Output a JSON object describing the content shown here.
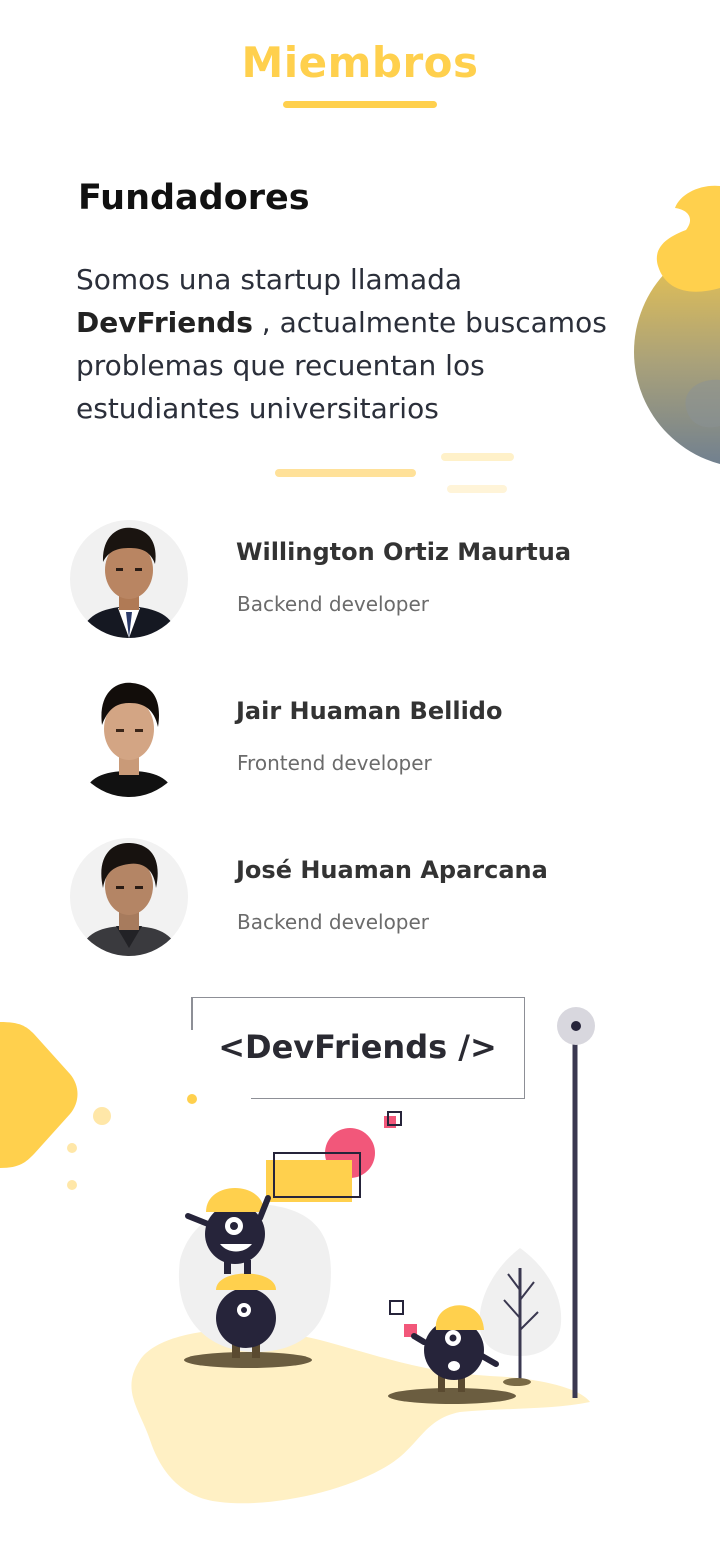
{
  "header": {
    "title": "Miembros"
  },
  "founders": {
    "title": "Fundadores",
    "intro_before": "Somos una startup llamada",
    "intro_brand": "DevFriends",
    "intro_after": ", actualmente buscamos problemas que recuentan los estudiantes universitarios"
  },
  "members": [
    {
      "name": "Willington Ortiz Maurtua",
      "role": "Backend developer"
    },
    {
      "name": "Jair Huaman Bellido",
      "role": "Frontend developer"
    },
    {
      "name": "José Huaman Aparcana",
      "role": "Backend developer"
    }
  ],
  "brand": {
    "label": "<DevFriends />"
  },
  "colors": {
    "accent": "#ffd04d",
    "text_dark": "#2b2f3a",
    "pink": "#f2577a",
    "navy": "#26243a"
  }
}
